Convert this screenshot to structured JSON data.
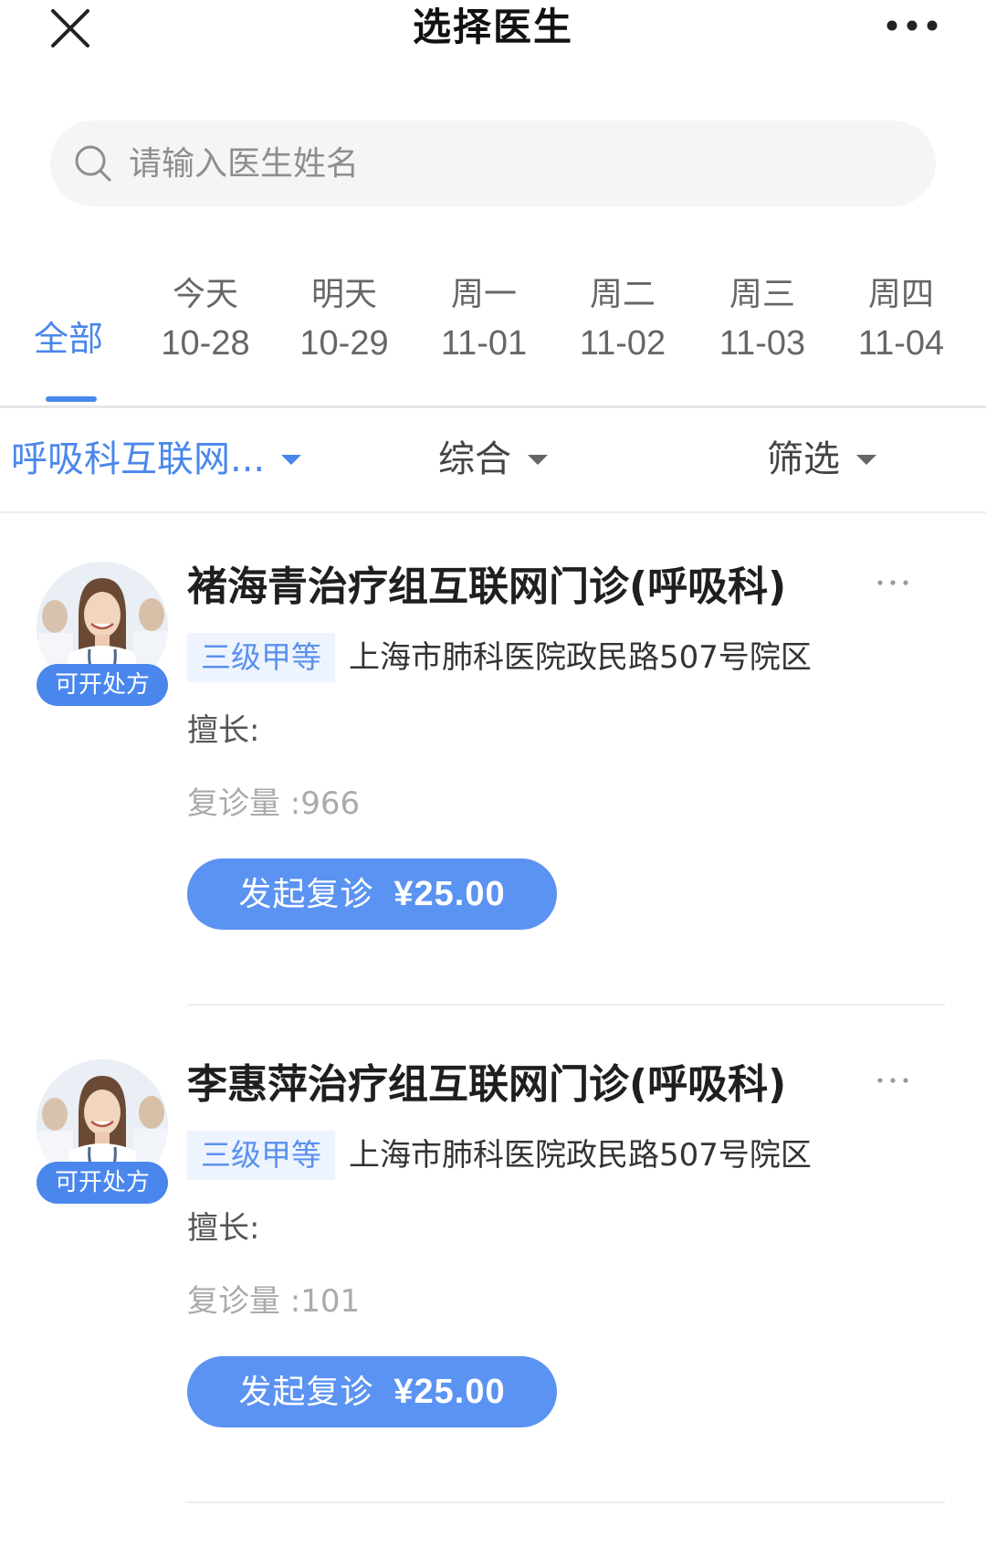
{
  "header": {
    "title": "选择医生",
    "close_icon": "close-icon",
    "more_icon": "more-horizontal-icon"
  },
  "search": {
    "placeholder": "请输入医生姓名",
    "value": "",
    "icon": "search-icon"
  },
  "date_tabs": [
    {
      "label": "全部",
      "date": "",
      "selected": true
    },
    {
      "label": "今天",
      "date": "10-28",
      "selected": false
    },
    {
      "label": "明天",
      "date": "10-29",
      "selected": false
    },
    {
      "label": "周一",
      "date": "11-01",
      "selected": false
    },
    {
      "label": "周二",
      "date": "11-02",
      "selected": false
    },
    {
      "label": "周三",
      "date": "11-03",
      "selected": false
    },
    {
      "label": "周四",
      "date": "11-04",
      "selected": false
    }
  ],
  "filters": {
    "department": "呼吸科互联网...",
    "sort": "综合",
    "screen": "筛选"
  },
  "doctors": [
    {
      "name": "褚海青治疗组互联网门诊(呼吸科)",
      "badge": "可开处方",
      "level": "三级甲等",
      "hospital": "上海市肺科医院政民路507号院区",
      "specialty": "擅长:",
      "visits_label": "复诊量",
      "visits_value": " :966",
      "button_label": "发起复诊",
      "price": "¥25.00"
    },
    {
      "name": "李惠萍治疗组互联网门诊(呼吸科)",
      "badge": "可开处方",
      "level": "三级甲等",
      "hospital": "上海市肺科医院政民路507号院区",
      "specialty": "擅长:",
      "visits_label": "复诊量",
      "visits_value": " :101",
      "button_label": "发起复诊",
      "price": "¥25.00"
    }
  ],
  "colors": {
    "accent": "#4a87ec",
    "button": "#5b93f2",
    "tag_bg": "#edf4fe",
    "muted_text": "#aaaaaa"
  }
}
